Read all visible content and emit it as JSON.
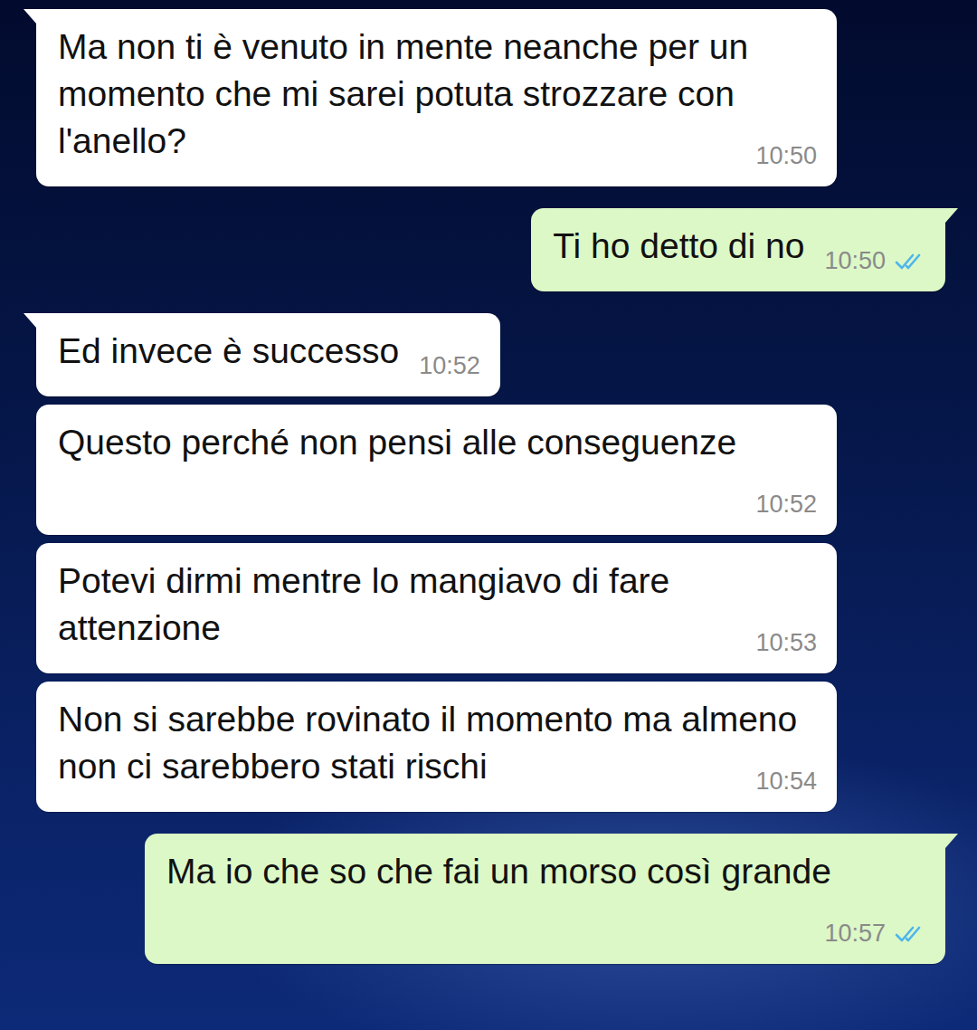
{
  "messages": [
    {
      "kind": "incoming",
      "text": "Ma non ti è venuto in mente neanche per un momento che mi sarei potuta strozzare con l'anello?",
      "time": "10:50"
    },
    {
      "kind": "outgoing",
      "text": "Ti ho detto di no",
      "time": "10:50",
      "read": true
    },
    {
      "kind": "incoming",
      "text": "Ed invece è successo",
      "time": "10:52"
    },
    {
      "kind": "incoming",
      "text": "Questo perché non pensi alle conseguenze",
      "time": "10:52"
    },
    {
      "kind": "incoming",
      "text": "Potevi dirmi mentre lo mangiavo di fare attenzione",
      "time": "10:53"
    },
    {
      "kind": "incoming",
      "text": "Non si sarebbe rovinato il momento ma almeno non ci sarebbero stati rischi",
      "time": "10:54"
    },
    {
      "kind": "outgoing",
      "text": "Ma io che so che fai un morso così grande",
      "time": "10:57",
      "read": true
    }
  ]
}
